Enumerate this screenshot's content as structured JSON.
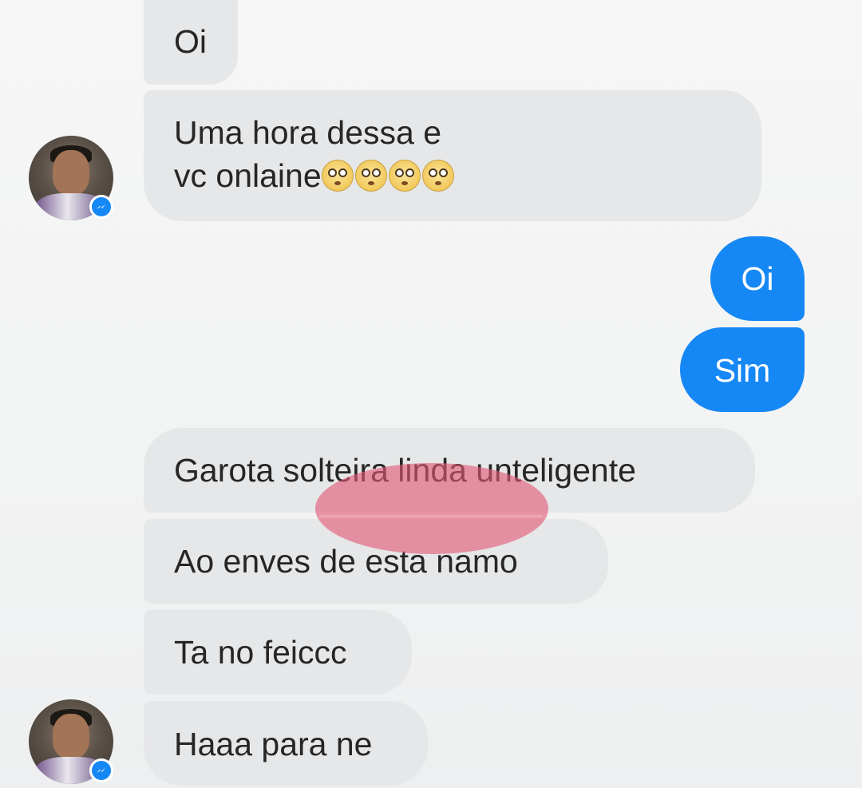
{
  "conversation": {
    "messages": [
      {
        "side": "received",
        "text": "Oi"
      },
      {
        "side": "received",
        "line1": "Uma hora dessa e",
        "line2": "vc onlaine",
        "emoji": "flushed-face-emoji",
        "emoji_count": 4
      },
      {
        "side": "sent",
        "text": "Oi"
      },
      {
        "side": "sent",
        "text": "Sim"
      },
      {
        "side": "received",
        "text": "Garota solteira linda unteligente"
      },
      {
        "side": "received",
        "text": "Ao enves de esta namo"
      },
      {
        "side": "received",
        "text": "Ta no feiccc"
      },
      {
        "side": "received",
        "text": "Haaa para ne"
      }
    ]
  },
  "icons": {
    "avatar": "profile-photo",
    "badge": "messenger-badge-icon"
  },
  "colors": {
    "sent_bubble": "#1688f5",
    "received_bubble": "#e6e7e8",
    "background": "#f3f4f4",
    "scribble": "#e25876"
  }
}
